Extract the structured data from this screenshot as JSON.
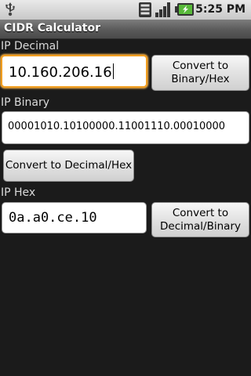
{
  "status_bar": {
    "time": "5:25 PM"
  },
  "app": {
    "title": "CIDR Calculator"
  },
  "decimal": {
    "label": "IP Decimal",
    "value": "10.160.206.16",
    "button": "Convert to\nBinary/Hex"
  },
  "binary": {
    "label": "IP Binary",
    "value": "00001010.10100000.11001110.00010000",
    "button": "Convert to Decimal/Hex"
  },
  "hex": {
    "label": "IP Hex",
    "value": "0a.a0.ce.10",
    "button": "Convert to\nDecimal/Binary"
  }
}
